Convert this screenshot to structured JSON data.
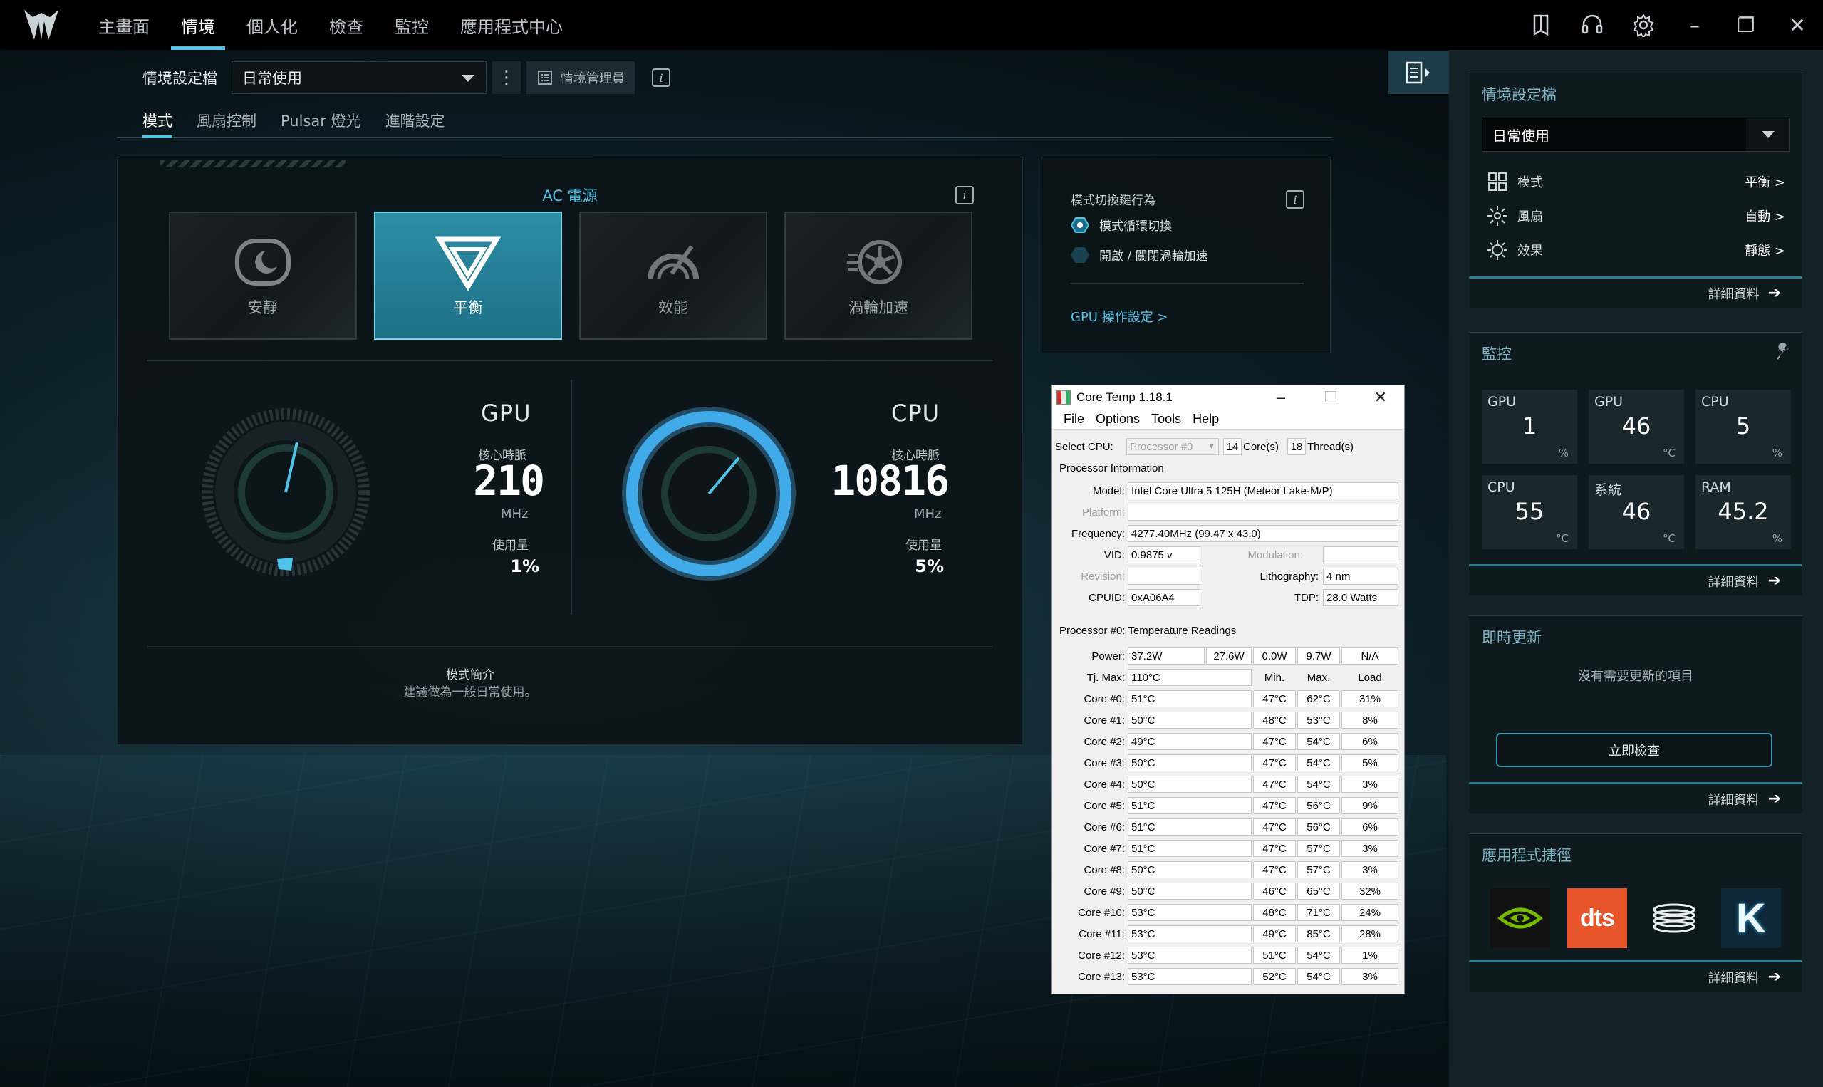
{
  "nav": {
    "tabs": [
      "主畫面",
      "情境",
      "個人化",
      "檢查",
      "監控",
      "應用程式中心"
    ],
    "active_tab": 1
  },
  "profile": {
    "label": "情境設定檔",
    "selected": "日常使用",
    "manager_label": "情境管理員"
  },
  "subtabs": [
    "模式",
    "風扇控制",
    "Pulsar 燈光",
    "進階設定"
  ],
  "power_source": "AC 電源",
  "modes": [
    {
      "label": "安靜",
      "icon": "quiet-mode-icon",
      "active": false
    },
    {
      "label": "平衡",
      "icon": "balanced-mode-icon",
      "active": true
    },
    {
      "label": "效能",
      "icon": "performance-mode-icon",
      "active": false
    },
    {
      "label": "渦輪加速",
      "icon": "turbo-mode-icon",
      "active": false
    }
  ],
  "gpu": {
    "title": "GPU",
    "clock_label": "核心時脈",
    "clock": "210",
    "clock_unit": "MHz",
    "usage_label": "使用量",
    "usage": "1%",
    "usage_fraction": 0.01
  },
  "cpu": {
    "title": "CPU",
    "clock_label": "核心時脈",
    "clock": "10816",
    "clock_unit": "MHz",
    "usage_label": "使用量",
    "usage": "5%",
    "usage_fraction": 0.05
  },
  "mode_desc": {
    "title": "模式簡介",
    "text": "建議做為一般日常使用。"
  },
  "switch_key": {
    "title": "模式切換鍵行為",
    "options": [
      "模式循環切換",
      "開啟 / 關閉渦輪加速"
    ],
    "selected": 0,
    "gpu_link": "GPU 操作設定 >"
  },
  "sidebar": {
    "profile_card": {
      "title": "情境設定檔",
      "selected": "日常使用",
      "rows": [
        {
          "label": "模式",
          "value": "平衡 >",
          "icon": "mode-grid-icon"
        },
        {
          "label": "風扇",
          "value": "自動 >",
          "icon": "fan-icon"
        },
        {
          "label": "效果",
          "value": "靜態 >",
          "icon": "light-effect-icon"
        }
      ],
      "details": "詳細資料"
    },
    "monitor_card": {
      "title": "監控",
      "tiles": [
        {
          "name": "GPU",
          "value": "1",
          "unit": "%"
        },
        {
          "name": "GPU",
          "value": "46",
          "unit": "°C"
        },
        {
          "name": "CPU",
          "value": "5",
          "unit": "%"
        },
        {
          "name": "CPU",
          "value": "55",
          "unit": "°C"
        },
        {
          "name": "系統",
          "value": "46",
          "unit": "°C"
        },
        {
          "name": "RAM",
          "value": "45.2",
          "unit": "%"
        }
      ],
      "details": "詳細資料"
    },
    "update_card": {
      "title": "即時更新",
      "message": "沒有需要更新的項目",
      "button": "立即檢查",
      "details": "詳細資料"
    },
    "apps_card": {
      "title": "應用程式捷徑",
      "apps": [
        "nvidia-app-icon",
        "dts-app-icon",
        "coil-app-icon",
        "k-app-icon"
      ],
      "dts_label": "dts",
      "k_label": "K",
      "details": "詳細資料"
    }
  },
  "coretemp": {
    "title": "Core Temp 1.18.1",
    "menu": [
      "File",
      "Options",
      "Tools",
      "Help"
    ],
    "select_cpu_label": "Select CPU:",
    "processor": "Processor #0",
    "cores": "14",
    "cores_label": "Core(s)",
    "threads": "18",
    "threads_label": "Thread(s)",
    "proc_info_label": "Processor Information",
    "model_label": "Model:",
    "model": "Intel Core Ultra 5 125H (Meteor Lake-M/P)",
    "platform_label": "Platform:",
    "frequency_label": "Frequency:",
    "frequency": "4277.40MHz (99.47 x 43.0)",
    "vid_label": "VID:",
    "vid": "0.9875 v",
    "modulation_label": "Modulation:",
    "revision_label": "Revision:",
    "lithography_label": "Lithography:",
    "lithography": "4 nm",
    "cpuid_label": "CPUID:",
    "cpuid": "0xA06A4",
    "tdp_label": "TDP:",
    "tdp": "28.0 Watts",
    "temp_label": "Processor #0: Temperature Readings",
    "power_label": "Power:",
    "power": [
      "37.2W",
      "27.6W",
      "0.0W",
      "9.7W",
      "N/A"
    ],
    "tjmax_label": "Tj. Max:",
    "tjmax": "110°C",
    "headers": [
      "Min.",
      "Max.",
      "Load"
    ],
    "cores_list": [
      {
        "name": "Core #0:",
        "temp": "51°C",
        "min": "47°C",
        "max": "62°C",
        "load": "31%"
      },
      {
        "name": "Core #1:",
        "temp": "50°C",
        "min": "48°C",
        "max": "53°C",
        "load": "8%"
      },
      {
        "name": "Core #2:",
        "temp": "49°C",
        "min": "47°C",
        "max": "54°C",
        "load": "6%"
      },
      {
        "name": "Core #3:",
        "temp": "50°C",
        "min": "47°C",
        "max": "54°C",
        "load": "5%"
      },
      {
        "name": "Core #4:",
        "temp": "50°C",
        "min": "47°C",
        "max": "54°C",
        "load": "3%"
      },
      {
        "name": "Core #5:",
        "temp": "51°C",
        "min": "47°C",
        "max": "56°C",
        "load": "9%"
      },
      {
        "name": "Core #6:",
        "temp": "51°C",
        "min": "47°C",
        "max": "56°C",
        "load": "6%"
      },
      {
        "name": "Core #7:",
        "temp": "51°C",
        "min": "47°C",
        "max": "57°C",
        "load": "3%"
      },
      {
        "name": "Core #8:",
        "temp": "50°C",
        "min": "47°C",
        "max": "57°C",
        "load": "3%"
      },
      {
        "name": "Core #9:",
        "temp": "50°C",
        "min": "46°C",
        "max": "65°C",
        "load": "32%"
      },
      {
        "name": "Core #10:",
        "temp": "53°C",
        "min": "48°C",
        "max": "71°C",
        "load": "24%"
      },
      {
        "name": "Core #11:",
        "temp": "53°C",
        "min": "49°C",
        "max": "85°C",
        "load": "28%"
      },
      {
        "name": "Core #12:",
        "temp": "53°C",
        "min": "51°C",
        "max": "54°C",
        "load": "1%"
      },
      {
        "name": "Core #13:",
        "temp": "53°C",
        "min": "52°C",
        "max": "54°C",
        "load": "3%"
      }
    ]
  },
  "colors": {
    "accent": "#4fc3e8",
    "cpu_ring": "#3aa6e6",
    "active_card": "#2d8ea6"
  }
}
